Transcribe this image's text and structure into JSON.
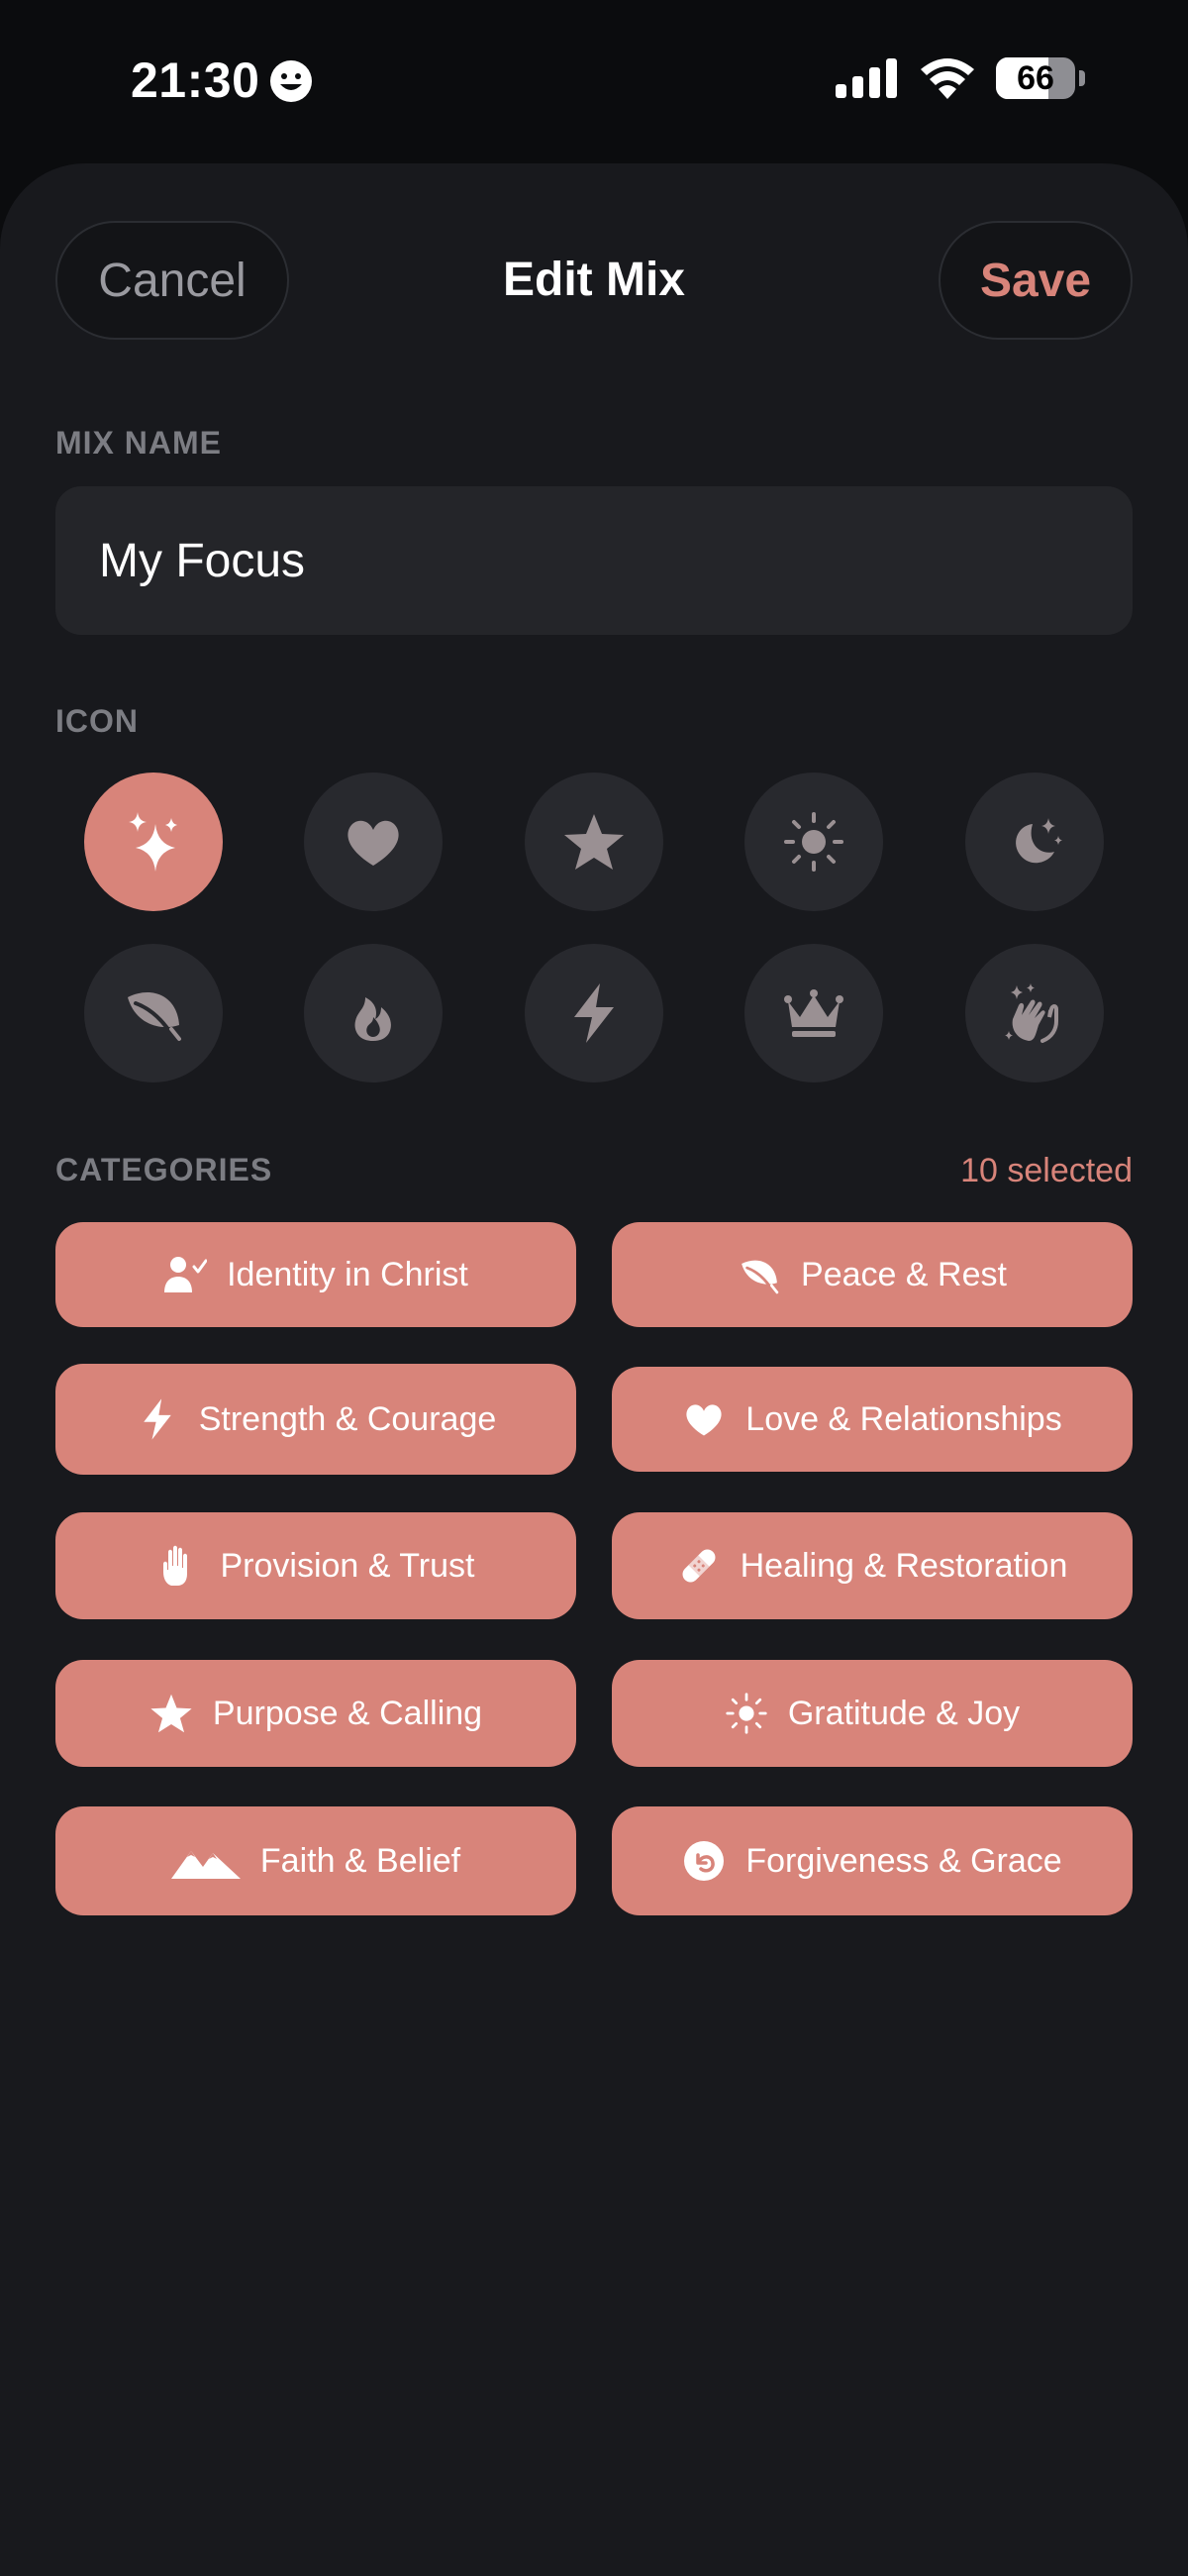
{
  "status_bar": {
    "time": "21:30",
    "battery": "66",
    "battery_level": 0.66
  },
  "header": {
    "cancel_label": "Cancel",
    "title": "Edit Mix",
    "save_label": "Save"
  },
  "mix_name": {
    "label": "MIX NAME",
    "value": "My Focus"
  },
  "icon_section": {
    "label": "ICON",
    "icons": [
      "sparkles-icon",
      "heart-icon",
      "star-icon",
      "sun-icon",
      "moon-stars-icon",
      "leaf-icon",
      "flame-icon",
      "bolt-icon",
      "crown-icon",
      "hands-clap-icon"
    ],
    "selected": "sparkles-icon"
  },
  "categories": {
    "label": "CATEGORIES",
    "selected_count": "10 selected",
    "items": [
      {
        "label": "Identity in Christ",
        "icon": "person-check-icon"
      },
      {
        "label": "Peace & Rest",
        "icon": "leaf-icon"
      },
      {
        "label": "Strength & Courage",
        "icon": "bolt-icon"
      },
      {
        "label": "Love & Relationships",
        "icon": "heart-icon"
      },
      {
        "label": "Provision & Trust",
        "icon": "hand-icon"
      },
      {
        "label": "Healing & Restoration",
        "icon": "bandage-icon"
      },
      {
        "label": "Purpose & Calling",
        "icon": "star-icon"
      },
      {
        "label": "Gratitude & Joy",
        "icon": "sun-icon"
      },
      {
        "label": "Faith & Belief",
        "icon": "mountains-icon"
      },
      {
        "label": "Forgiveness & Grace",
        "icon": "arrow-uturn-circle-icon"
      }
    ]
  },
  "colors": {
    "accent": "#d8847a",
    "background": "#18191d",
    "input_background": "#242529",
    "icon_background": "#28292e",
    "icon_muted": "#9a9093",
    "label_muted": "#7c7d83"
  }
}
